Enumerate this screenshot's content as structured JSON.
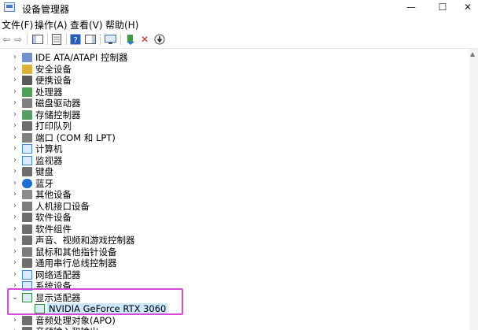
{
  "window": {
    "title": "设备管理器",
    "min": "—",
    "max": "☐",
    "close": "✕"
  },
  "menu": [
    "文件(F)",
    "操作(A)",
    "查看(V)",
    "帮助(H)"
  ],
  "toolbar": {
    "back": "⇦",
    "forward": "⇨",
    "uninstall": "✕",
    "update": "⬇"
  },
  "tree": {
    "categories": [
      {
        "label": "IDE ATA/ATAPI 控制器",
        "icon": "ide-controller-icon",
        "color": "#5b7fbf"
      },
      {
        "label": "安全设备",
        "icon": "security-device-icon",
        "color": "#d8a21a"
      },
      {
        "label": "便携设备",
        "icon": "portable-device-icon",
        "color": "#3d3d3d"
      },
      {
        "label": "处理器",
        "icon": "processor-icon",
        "color": "#2f8f3a"
      },
      {
        "label": "磁盘驱动器",
        "icon": "disk-drive-icon",
        "color": "#6a6a6a"
      },
      {
        "label": "存储控制器",
        "icon": "storage-controller-icon",
        "color": "#3a8a4a"
      },
      {
        "label": "打印队列",
        "icon": "printer-icon",
        "color": "#555555"
      },
      {
        "label": "端口 (COM 和 LPT)",
        "icon": "port-icon",
        "color": "#6a6a6a"
      },
      {
        "label": "计算机",
        "icon": "computer-icon",
        "color": "#3c88d8"
      },
      {
        "label": "监视器",
        "icon": "monitor-icon",
        "color": "#3c88d8"
      },
      {
        "label": "键盘",
        "icon": "keyboard-icon",
        "color": "#555555"
      },
      {
        "label": "蓝牙",
        "icon": "bluetooth-icon",
        "color": "#1f6fd0"
      },
      {
        "label": "其他设备",
        "icon": "other-device-icon",
        "color": "#777777"
      },
      {
        "label": "人机接口设备",
        "icon": "hid-icon",
        "color": "#666666"
      },
      {
        "label": "软件设备",
        "icon": "software-device-icon",
        "color": "#555555"
      },
      {
        "label": "软件组件",
        "icon": "software-component-icon",
        "color": "#555555"
      },
      {
        "label": "声音、视频和游戏控制器",
        "icon": "sound-icon",
        "color": "#555555"
      },
      {
        "label": "鼠标和其他指针设备",
        "icon": "mouse-icon",
        "color": "#666666"
      },
      {
        "label": "通用串行总线控制器",
        "icon": "usb-icon",
        "color": "#555555"
      },
      {
        "label": "网络适配器",
        "icon": "network-adapter-icon",
        "color": "#3c88d8"
      },
      {
        "label": "系统设备",
        "icon": "system-device-icon",
        "color": "#3c88d8"
      },
      {
        "label": "显示适配器",
        "icon": "display-adapter-icon",
        "color": "#2f8f3a",
        "expanded": true
      },
      {
        "label": "NVIDIA GeForce RTX 3060",
        "icon": "gpu-icon",
        "color": "#2f8f3a",
        "child": true
      },
      {
        "label": "音频处理对象(APO)",
        "icon": "audio-processing-icon",
        "color": "#555555"
      },
      {
        "label": "音频输入和输出",
        "icon": "audio-io-icon",
        "color": "#555555"
      }
    ]
  }
}
